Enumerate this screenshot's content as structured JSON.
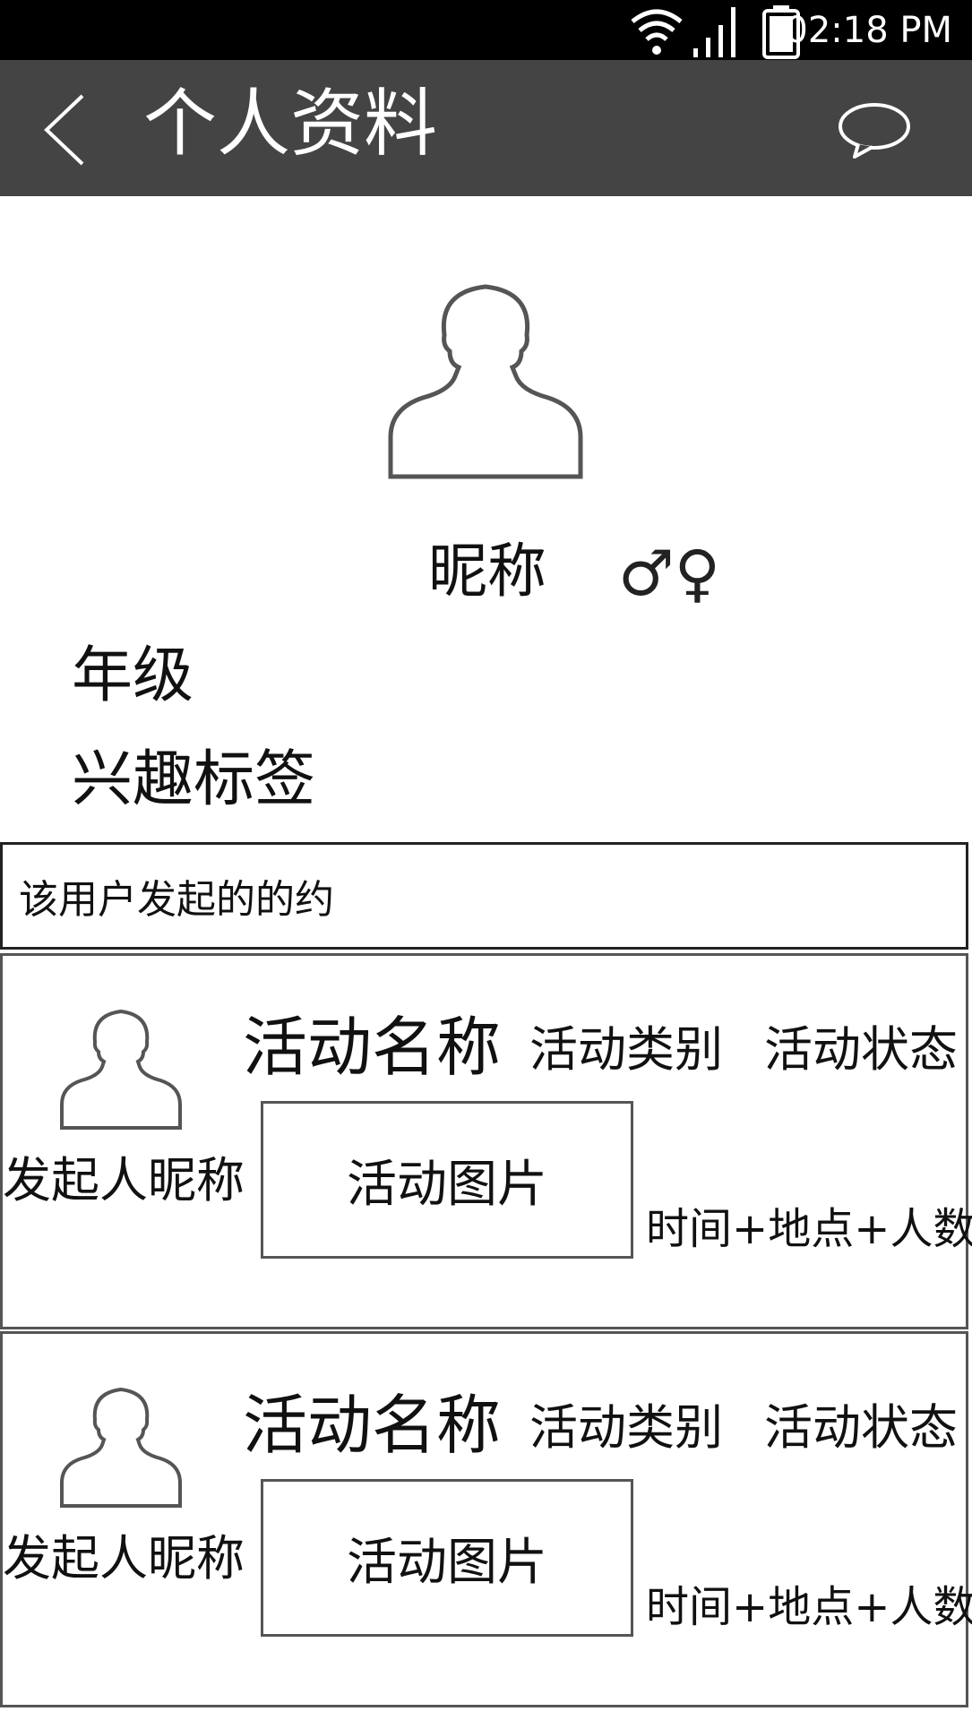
{
  "status_bar": {
    "time": "02:18 PM"
  },
  "app_bar": {
    "title": "个人资料"
  },
  "profile": {
    "nickname": "昵称",
    "gender_symbols": "♂♀",
    "grade": "年级",
    "interest_tags": "兴趣标签"
  },
  "section": {
    "header": "该用户发起的的约"
  },
  "activities": [
    {
      "initiator": "发起人昵称",
      "name": "活动名称",
      "category": "活动类别",
      "status": "活动状态",
      "image_label": "活动图片",
      "meta": "时间+地点+人数"
    },
    {
      "initiator": "发起人昵称",
      "name": "活动名称",
      "category": "活动类别",
      "status": "活动状态",
      "image_label": "活动图片",
      "meta": "时间+地点+人数"
    }
  ]
}
